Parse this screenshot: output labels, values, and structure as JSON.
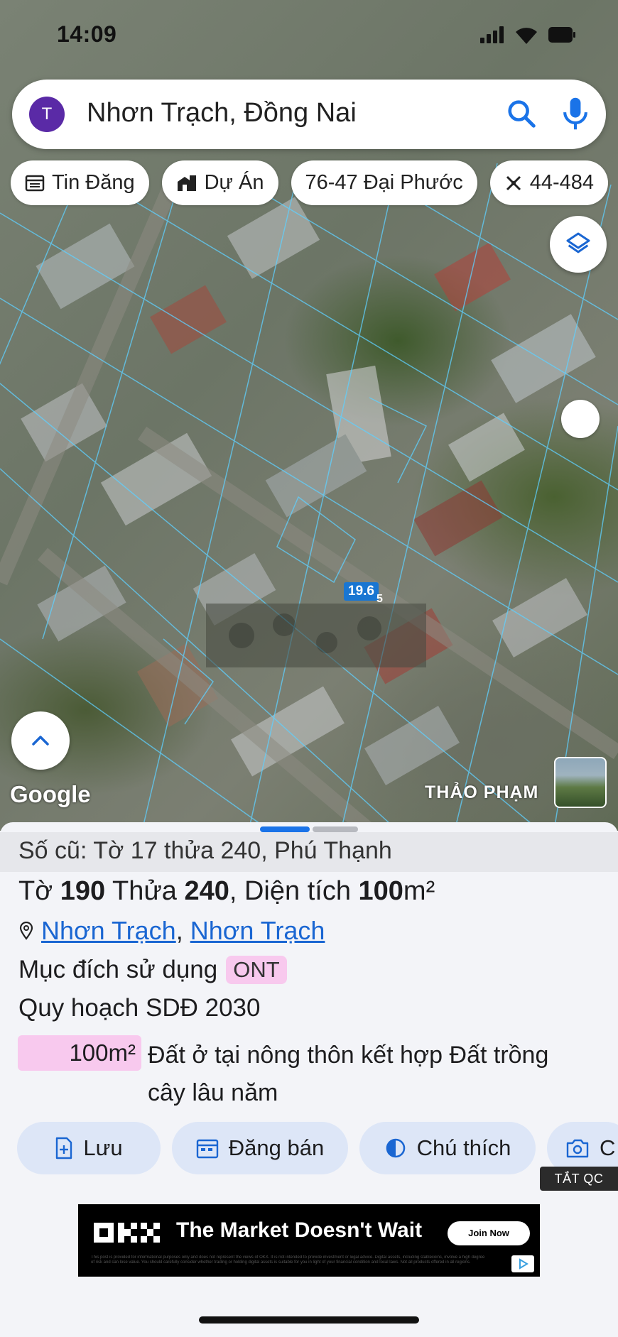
{
  "status_bar": {
    "time": "14:09"
  },
  "search": {
    "avatar_letter": "T",
    "query": "Nhơn Trạch, Đồng Nai"
  },
  "chips": [
    {
      "label": "Tin Đăng",
      "icon": "listing-icon"
    },
    {
      "label": "Dự Án",
      "icon": "project-building-icon"
    },
    {
      "label": "76-47 Đại Phước",
      "icon": ""
    },
    {
      "label": "44-484",
      "icon": "compass-tools-icon"
    }
  ],
  "map": {
    "parcel_label": "19.6",
    "parcel_label_2": "5",
    "google_logo": "Google",
    "watermark": "THẢO PHẠM"
  },
  "sheet": {
    "old_parcel": "Số cũ: Tờ 17 thửa 240, Phú Thạnh",
    "sheet_prefix": "Tờ ",
    "sheet_no": "190",
    "parcel_prefix": " Thửa ",
    "parcel_no": "240",
    "area_prefix": ", Diện tích ",
    "area_value": "100",
    "area_unit": "m²",
    "location_1": "Nhơn Trạch",
    "location_sep": ",",
    "location_2": "Nhơn Trạch",
    "purpose_label": "Mục đích sử dụng",
    "purpose_code": "ONT",
    "plan_label": "Quy hoạch SDĐ 2030",
    "plan_area": "100m²",
    "plan_desc_line1": "Đất ở tại nông thôn kết hợp Đất trồng",
    "plan_desc_line2": "cây lâu năm",
    "colors": {
      "link": "#1a66d2",
      "badge": "#f8c9ee",
      "button_bg": "#dde6f7",
      "accent": "#1a73e8"
    }
  },
  "actions": [
    {
      "label": "Lưu",
      "icon": "save-doc-icon"
    },
    {
      "label": "Đăng bán",
      "icon": "calendar-icon"
    },
    {
      "label": "Chú thích",
      "icon": "contrast-icon"
    },
    {
      "label": "C",
      "icon": "camera-add-icon"
    }
  ],
  "ad": {
    "tag": "TẮT QC",
    "headline": "The Market Doesn't Wait",
    "cta": "Join Now",
    "fine_print": "This post is provided for informational purposes only and does not represent the views of OKX. It is not intended to provide investment or legal advice. Digital assets, including stablecoins, involve a high degree of risk and can lose value. You should carefully consider whether trading or holding digital assets is suitable for you in light of your financial condition and local laws. Not all products offered in all regions."
  }
}
